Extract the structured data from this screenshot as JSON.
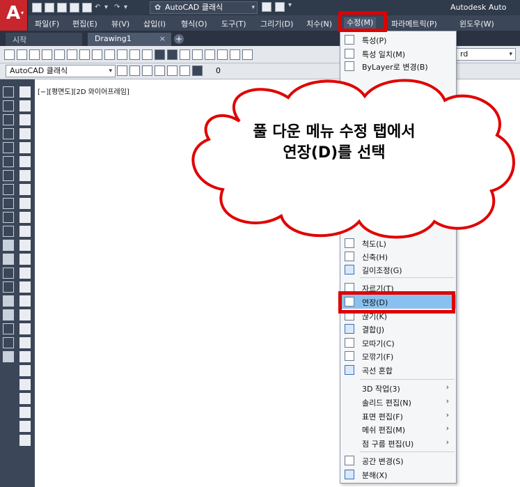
{
  "titlebar": {
    "workspace": "AutoCAD 클래식",
    "app_name": "Autodesk Auto"
  },
  "menubar": {
    "items": [
      "파일(F)",
      "편집(E)",
      "뷰(V)",
      "삽입(I)",
      "형식(O)",
      "도구(T)",
      "그리기(D)",
      "치수(N)",
      "수정(M)",
      "파라메트릭(P)",
      "윈도우(W)"
    ]
  },
  "tabs": {
    "start": "시작",
    "drawing": "Drawing1",
    "close": "×",
    "add": "+"
  },
  "toolbar2": {
    "workspace_select": "AutoCAD 클래식",
    "layer_value": "0",
    "right_select": "rd"
  },
  "canvas": {
    "viewport_label": "[−][평면도][2D 와이어프레임]"
  },
  "dropdown": {
    "top_items": [
      {
        "label": "특성(P)"
      },
      {
        "label": "특성 일치(M)"
      },
      {
        "label": "ByLayer로 변경(B)"
      }
    ],
    "mid_items": [
      {
        "label": "척도(L)"
      },
      {
        "label": "신축(H)"
      },
      {
        "label": "길이조정(G)"
      },
      {
        "label": "자르기(T)"
      },
      {
        "label": "연장(D)"
      },
      {
        "label": "끊기(K)"
      },
      {
        "label": "결합(J)"
      },
      {
        "label": "모따기(C)"
      },
      {
        "label": "모깎기(F)"
      },
      {
        "label": "곡선 혼합"
      }
    ],
    "sub_items": [
      {
        "label": "3D 작업(3)",
        "arrow": "›"
      },
      {
        "label": "솔리드 편집(N)",
        "arrow": "›"
      },
      {
        "label": "표면 편집(F)",
        "arrow": "›"
      },
      {
        "label": "메쉬 편집(M)",
        "arrow": "›"
      },
      {
        "label": "점 구름 편집(U)",
        "arrow": "›"
      }
    ],
    "bottom_items": [
      {
        "label": "공간 변경(S)"
      },
      {
        "label": "분해(X)"
      }
    ]
  },
  "callout": {
    "line1": "풀 다운 메뉴 수정 탭에서",
    "line2": "연장(D)를 선택"
  },
  "colors": {
    "highlight": "#e00000",
    "selected_item": "#88c1ef",
    "app_red": "#c8252c",
    "menubar": "#3b4658"
  }
}
